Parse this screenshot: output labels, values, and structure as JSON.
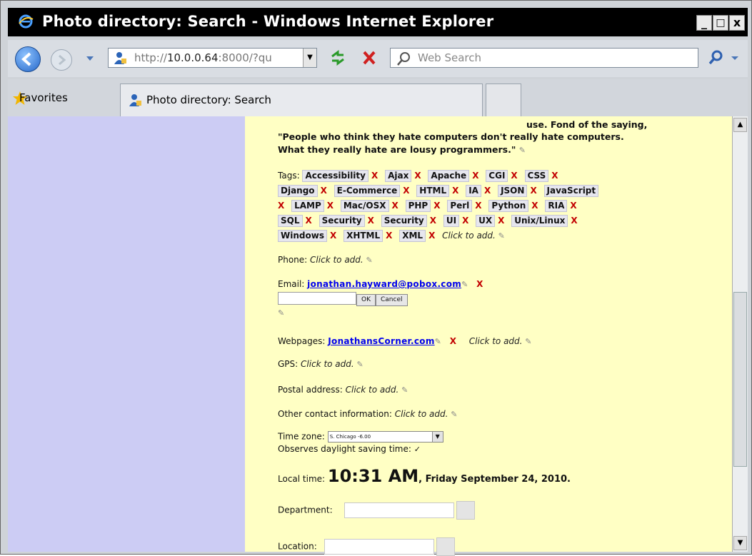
{
  "window": {
    "title": "Photo directory: Search - Windows Internet Explorer",
    "minimize": "_",
    "maximize": "□",
    "close": "x"
  },
  "nav": {
    "url_prefix": "http://",
    "url_host": "10.0.0.64",
    "url_rest": ":8000/?qu",
    "search_placeholder": "Web Search"
  },
  "tabs": {
    "favorites_label": "Favorites",
    "active_tab": "Photo directory: Search"
  },
  "profile": {
    "quote_line0": "use. Fond of the saying,",
    "quote_line1": "\"People who think they hate computers don't really hate computers.",
    "quote_line2": "What they really hate are lousy programmers.\"",
    "tags_label": "Tags:",
    "tags": [
      "Accessibility",
      "Ajax",
      "Apache",
      "CGI",
      "CSS",
      "Django",
      "E-Commerce",
      "HTML",
      "IA",
      "JSON",
      "JavaScript",
      "LAMP",
      "Mac/OSX",
      "PHP",
      "Perl",
      "Python",
      "RIA",
      "SQL",
      "Security",
      "Security",
      "UI",
      "UX",
      "Unix/Linux",
      "Windows",
      "XHTML",
      "XML"
    ],
    "click_to_add": "Click to add.",
    "phone_label": "Phone:",
    "email_label": "Email:",
    "email_value": "jonathan.hayward@pobox.com",
    "ok_label": "OK",
    "cancel_label": "Cancel",
    "webpages_label": "Webpages:",
    "webpage_value": "JonathansCorner.com",
    "gps_label": "GPS:",
    "postal_label": "Postal address:",
    "other_label": "Other contact information:",
    "timezone_label": "Time zone:",
    "timezone_value": "S. Chicago -6.00",
    "dst_label": "Observes daylight saving time:",
    "localtime_label": "Local time:",
    "localtime_time": "10:31 AM",
    "localtime_date": ", Friday September 24, 2010.",
    "department_label": "Department:",
    "location_label": "Location:"
  },
  "colors": {
    "left_panel": "#ccccf4",
    "main_panel": "#ffffc4",
    "delete_x": "#c20000",
    "link": "#0000ee"
  }
}
